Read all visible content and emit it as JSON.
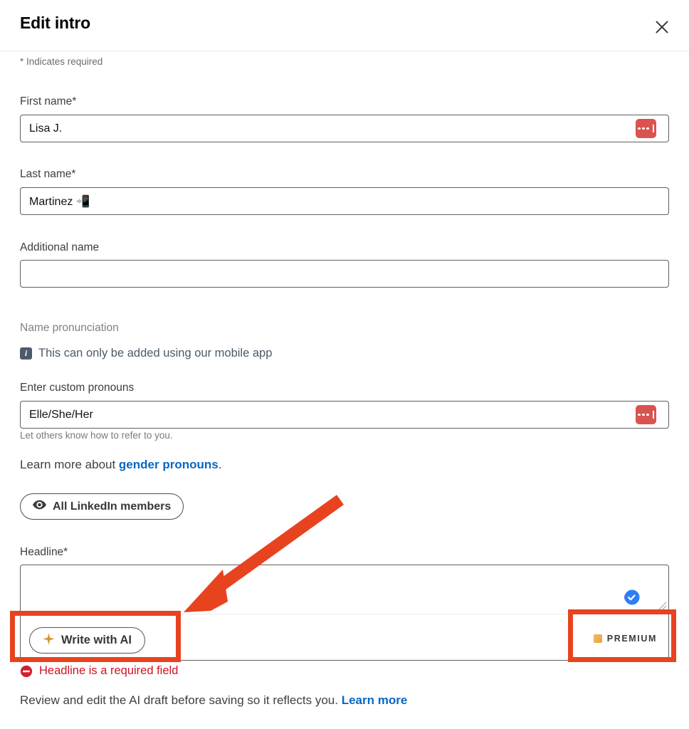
{
  "header": {
    "title": "Edit intro",
    "close_label": "Close",
    "close_icon": "close-icon"
  },
  "form": {
    "required_note": "* Indicates required",
    "first_name": {
      "label": "First name*",
      "value": "Lisa J.",
      "placeholder": "",
      "badge_icon": "password-manager-icon"
    },
    "last_name": {
      "label": "Last name*",
      "value": "Martinez 📲",
      "placeholder": ""
    },
    "additional_name": {
      "label": "Additional name",
      "value": "",
      "placeholder": ""
    },
    "name_pronunciation": {
      "label": "Name pronunciation",
      "info_icon": "info-icon",
      "info_text": "This can only be added using our mobile app"
    },
    "pronouns": {
      "label": "Enter custom pronouns",
      "value": "Elle/She/Her",
      "placeholder": "",
      "helper": "Let others know how to refer to you.",
      "badge_icon": "password-manager-icon"
    },
    "learn_more_line": {
      "prefix": "Learn more about ",
      "link": "gender pronouns",
      "suffix": "."
    },
    "visibility": {
      "icon": "eye-icon",
      "label": "All LinkedIn members"
    },
    "headline": {
      "label": "Headline*",
      "value": "",
      "placeholder": "",
      "ai_button": {
        "icon": "sparkle-icon",
        "label": "Write with AI"
      },
      "premium_tag": {
        "icon": "premium-square-icon",
        "label": "PREMIUM"
      },
      "verified_icon": "verified-check-icon",
      "resize_handle": "resize-handle-icon",
      "error": {
        "icon": "error-blocked-icon",
        "text": "Headline is a required field"
      }
    },
    "footer_note": {
      "text": "Review and edit the AI draft before saving so it reflects you. ",
      "link": "Learn more"
    }
  },
  "annotations": {
    "color": "#e8431f",
    "arrow": "arrow-pointing-to-write-with-ai",
    "box_ai": "highlight-write-with-ai-button",
    "box_premium": "highlight-premium-badge"
  }
}
